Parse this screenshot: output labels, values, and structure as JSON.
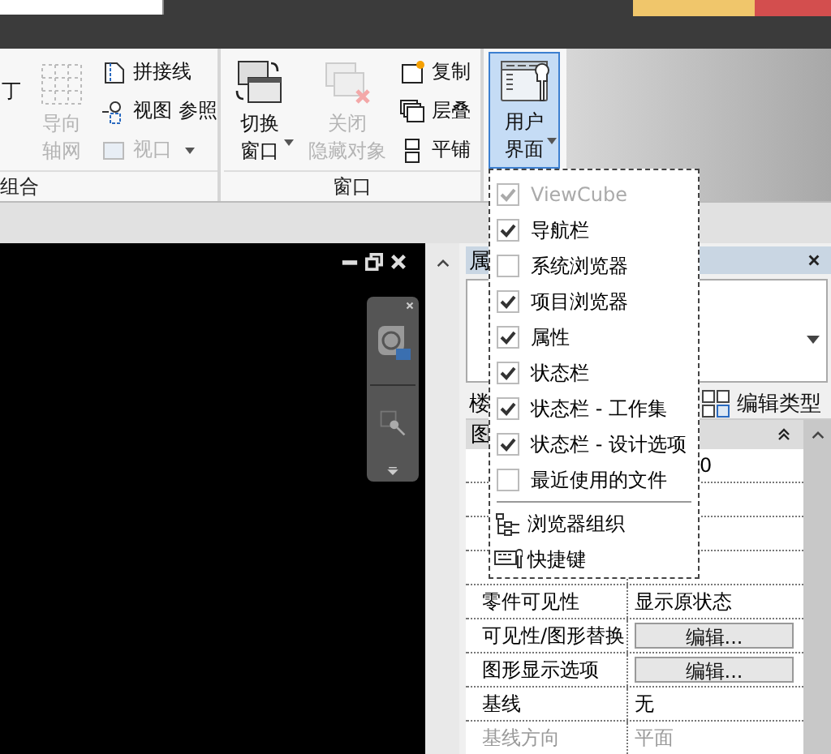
{
  "ribbon": {
    "groups": [
      {
        "label": "组合",
        "tools": [
          {
            "kind": "big",
            "lines": [
              "丁"
            ],
            "disabled": false,
            "dropdown": false,
            "open": false
          },
          {
            "kind": "big",
            "lines": [
              "导向",
              "轴网"
            ],
            "disabled": true,
            "dropdown": false,
            "open": false
          },
          {
            "kind": "small",
            "lines": [
              "拼接线"
            ],
            "disabled": false,
            "dropdown": false
          },
          {
            "kind": "small",
            "lines": [
              "视图 参照"
            ],
            "disabled": false,
            "dropdown": false
          },
          {
            "kind": "small",
            "lines": [
              "视口"
            ],
            "disabled": true,
            "dropdown": true
          }
        ]
      },
      {
        "label": "窗口",
        "tools": [
          {
            "kind": "big",
            "lines": [
              "切换",
              "窗口"
            ],
            "disabled": false,
            "dropdown": true,
            "open": false
          },
          {
            "kind": "big",
            "lines": [
              "关闭",
              "隐藏对象"
            ],
            "disabled": true,
            "dropdown": false,
            "open": false
          },
          {
            "kind": "small",
            "lines": [
              "复制"
            ],
            "disabled": false,
            "dropdown": false
          },
          {
            "kind": "small",
            "lines": [
              "层叠"
            ],
            "disabled": false,
            "dropdown": false
          },
          {
            "kind": "small",
            "lines": [
              "平铺"
            ],
            "disabled": false,
            "dropdown": false
          }
        ]
      },
      {
        "tools": [
          {
            "kind": "big",
            "lines": [
              "用户",
              "界面"
            ],
            "disabled": false,
            "dropdown": true,
            "open": true
          }
        ]
      }
    ]
  },
  "menu": {
    "items": [
      {
        "kind": "check",
        "label": "ViewCube",
        "checked": true,
        "disabled": true
      },
      {
        "kind": "check",
        "label": "导航栏",
        "checked": true,
        "disabled": false
      },
      {
        "kind": "check",
        "label": "系统浏览器",
        "checked": false,
        "disabled": false
      },
      {
        "kind": "check",
        "label": "项目浏览器",
        "checked": true,
        "disabled": false
      },
      {
        "kind": "check",
        "label": "属性",
        "checked": true,
        "disabled": false
      },
      {
        "kind": "check",
        "label": "状态栏",
        "checked": true,
        "disabled": false
      },
      {
        "kind": "check",
        "label": "状态栏 - 工作集",
        "checked": true,
        "disabled": false
      },
      {
        "kind": "check",
        "label": "状态栏 - 设计选项",
        "checked": true,
        "disabled": false
      },
      {
        "kind": "check",
        "label": "最近使用的文件",
        "checked": false,
        "disabled": false
      },
      {
        "kind": "separator"
      },
      {
        "kind": "command",
        "label": "浏览器组织"
      },
      {
        "kind": "command",
        "label": "快捷键"
      }
    ]
  },
  "properties": {
    "title": "属",
    "type_row_label": "楼",
    "edit_type_button": "编辑类型",
    "section": "图",
    "rows": [
      {
        "kind": "covered",
        "value": "0"
      },
      {
        "kind": "covered"
      },
      {
        "kind": "covered"
      },
      {
        "kind": "covered"
      },
      {
        "kind": "text",
        "label": "零件可见性",
        "value": "显示原状态",
        "disabled": false
      },
      {
        "kind": "button",
        "label": "可见性/图形替换",
        "value": "编辑...",
        "disabled": false
      },
      {
        "kind": "button",
        "label": "图形显示选项",
        "value": "编辑...",
        "disabled": false
      },
      {
        "kind": "text",
        "label": "基线",
        "value": "无",
        "disabled": false
      },
      {
        "kind": "text",
        "label": "基线方向",
        "value": "平面",
        "disabled": true
      }
    ]
  }
}
